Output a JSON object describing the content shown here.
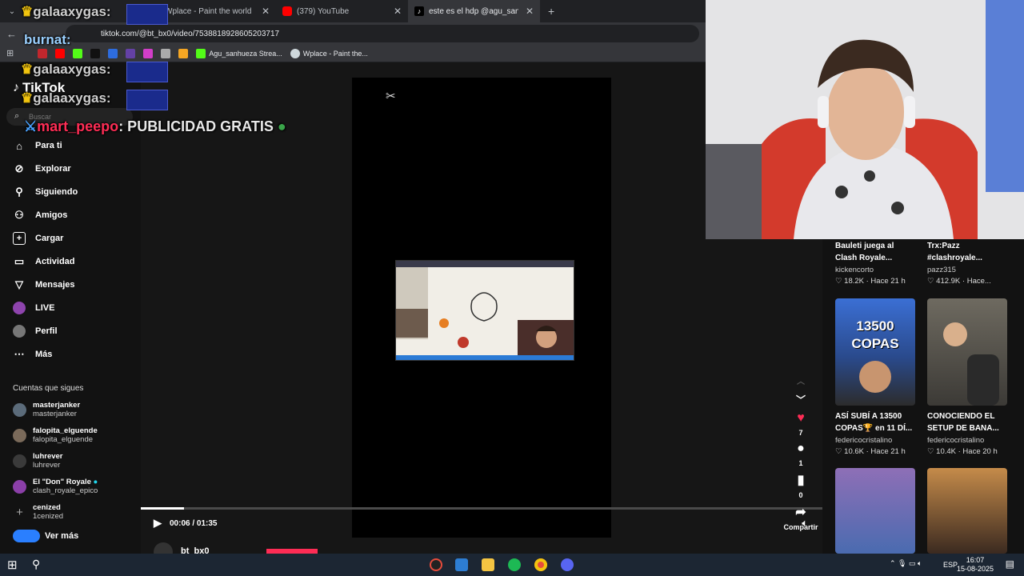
{
  "browser": {
    "tabs": [
      {
        "label": "Wplace - Paint the world",
        "favicon_color": "#cfd8dc"
      },
      {
        "label": "(379) YouTube",
        "favicon_color": "#ff0000"
      },
      {
        "label": "este es el hdp @agu_sanhueza",
        "favicon_color": "#000000"
      }
    ],
    "new_tab": "+",
    "url": "tiktok.com/@bt_bx0/video/7538818928605203717",
    "bookmarks": [
      {
        "label": "Agu_sanhueza Strea...",
        "icon_color": "#53fc18"
      },
      {
        "label": "Wplace - Paint the...",
        "icon_color": "#cfd8dc"
      }
    ]
  },
  "tiktok": {
    "logo": "TikTok",
    "search_placeholder": "Buscar",
    "nav": [
      {
        "label": "Para ti",
        "icon": "home-icon"
      },
      {
        "label": "Explorar",
        "icon": "compass-icon"
      },
      {
        "label": "Siguiendo",
        "icon": "following-icon"
      },
      {
        "label": "Amigos",
        "icon": "friends-icon"
      },
      {
        "label": "Cargar",
        "icon": "upload-icon"
      },
      {
        "label": "Actividad",
        "icon": "activity-icon"
      },
      {
        "label": "Mensajes",
        "icon": "messages-icon"
      },
      {
        "label": "LIVE",
        "icon": "live-icon"
      },
      {
        "label": "Perfil",
        "icon": "profile-icon"
      },
      {
        "label": "Más",
        "icon": "more-icon"
      }
    ],
    "following_header": "Cuentas que sigues",
    "following": [
      {
        "name": "masterjanker",
        "handle": "masterjanker"
      },
      {
        "name": "falopita_elguende",
        "handle": "falopita_elguende"
      },
      {
        "name": "luhrever",
        "handle": "luhrever"
      },
      {
        "name": "El \"Don\" Royale",
        "handle": "clash_royale_epico"
      },
      {
        "name": "cenized",
        "handle": "1cenized"
      }
    ],
    "see_more": "Ver más",
    "player": {
      "time": "00:06 / 01:35",
      "progress": 0.063,
      "author": "bt_bx0"
    },
    "actions": {
      "likes": "7",
      "comments": "1",
      "saves": "0",
      "share": "Compartir"
    },
    "related": [
      {
        "title": "Bauleti juega al Clash Royale...",
        "user": "kickencorto",
        "stats": "♡ 18.2K · Hace 21 h"
      },
      {
        "title": "Trx:Pazz #clashroyale...",
        "user": "pazz315",
        "stats": "♡ 412.9K · Hace..."
      },
      {
        "title": "ASÍ SUBÍ A 13500 COPAS🏆 en 11 DÍ...",
        "user": "federicocristalino",
        "stats": "♡ 10.6K · Hace 21 h",
        "thumb_text": "13500 COPAS"
      },
      {
        "title": "CONOCIENDO EL SETUP DE BANA...",
        "user": "federicocristalino",
        "stats": "♡ 10.4K · Hace 20 h"
      }
    ]
  },
  "overlay_chat": [
    {
      "user": "galaaxygas:"
    },
    {
      "user": "burnat:"
    },
    {
      "user": "galaaxygas:"
    },
    {
      "user": "galaaxygas:"
    },
    {
      "user": "mart_peepo",
      "message": ": PUBLICIDAD GRATIS"
    }
  ],
  "taskbar": {
    "language": "ESP",
    "time": "16:07",
    "date": "15-08-2025"
  }
}
